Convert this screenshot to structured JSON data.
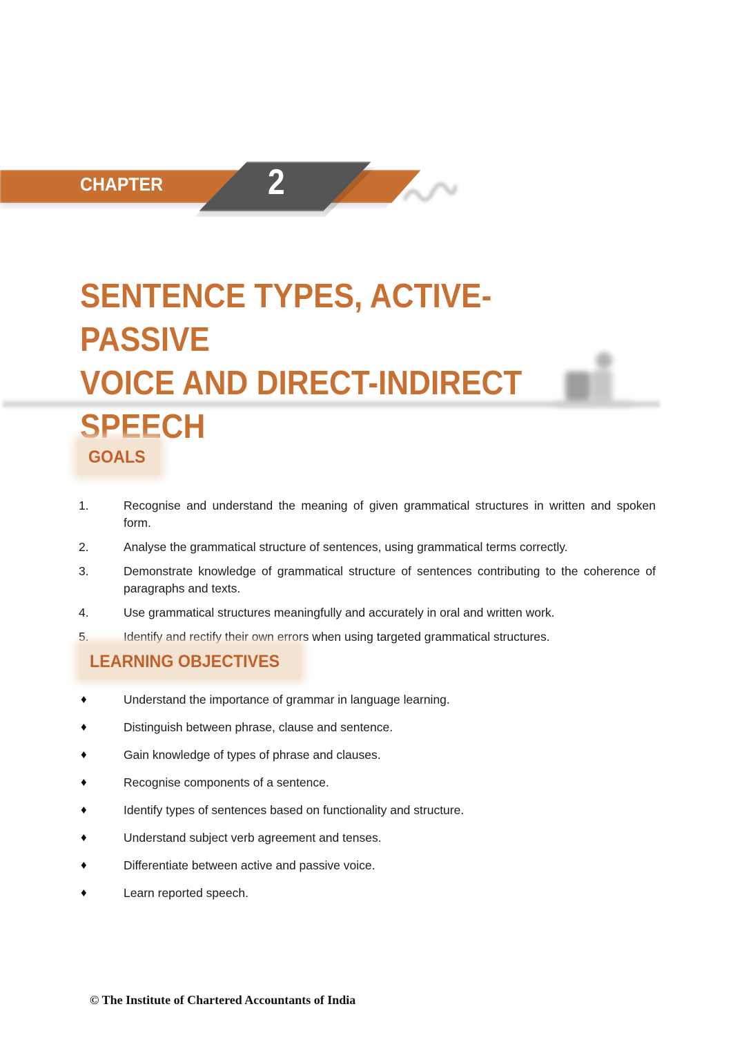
{
  "banner": {
    "label": "CHAPTER",
    "number": "2"
  },
  "title": {
    "lines": [
      "SENTENCE TYPES, ACTIVE-PASSIVE",
      "VOICE AND DIRECT-INDIRECT",
      "SPEECH"
    ]
  },
  "goals": {
    "heading": "GOALS",
    "items": [
      {
        "num": "1.",
        "text": "Recognise and understand the meaning of given grammatical structures in written and spoken form."
      },
      {
        "num": "2.",
        "text": "Analyse the grammatical structure of sentences, using grammatical terms correctly."
      },
      {
        "num": "3.",
        "text": "Demonstrate knowledge of grammatical structure of sentences contributing to the coherence of paragraphs and texts."
      },
      {
        "num": "4.",
        "text": "Use grammatical structures meaningfully and accurately in oral and written work."
      },
      {
        "num": "5.",
        "text": "Identify and rectify their own errors when using targeted grammatical structures."
      }
    ]
  },
  "learning_objectives": {
    "heading": "LEARNING OBJECTIVES",
    "bullet": "♦",
    "items": [
      "Understand the importance of grammar in language learning.",
      "Distinguish between phrase, clause and sentence.",
      "Gain knowledge of types of phrase and clauses.",
      "Recognise components of a sentence.",
      "Identify types of sentences based on functionality and structure.",
      "Understand subject verb agreement and tenses.",
      "Differentiate between active and passive voice.",
      "Learn reported speech."
    ]
  },
  "footer": {
    "copyright": "© The Institute of Chartered Accountants of India"
  },
  "colors": {
    "accent_orange": "#c87032",
    "heading_orange": "#c0602a",
    "banner_dark": "#555555",
    "section_bg": "#f2e3d2"
  }
}
